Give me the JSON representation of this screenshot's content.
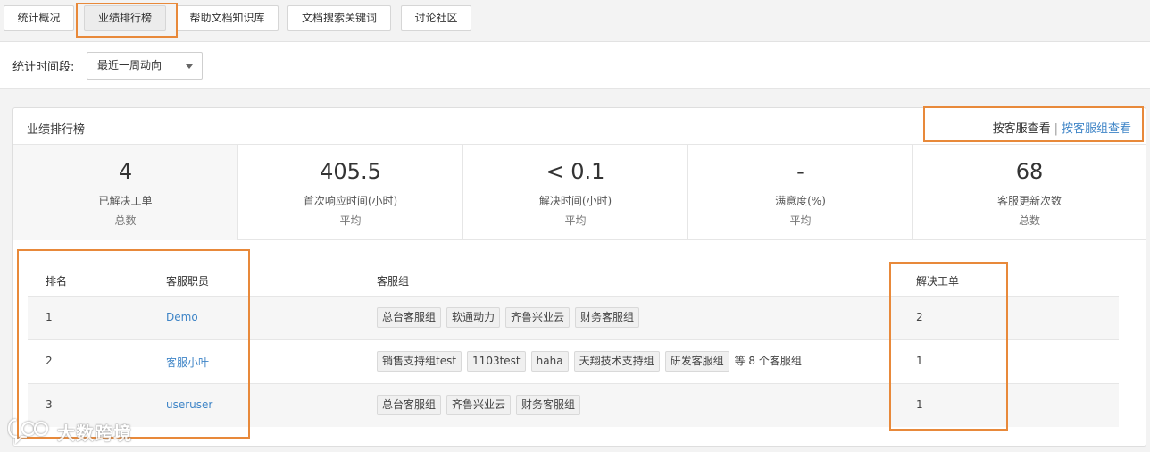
{
  "tabs": [
    {
      "label": "统计概况"
    },
    {
      "label": "业绩排行榜"
    },
    {
      "label": "帮助文档知识库"
    },
    {
      "label": "文档搜索关键词"
    },
    {
      "label": "讨论社区"
    }
  ],
  "filter": {
    "label": "统计时间段:",
    "selected": "最近一周动向"
  },
  "panel": {
    "title": "业绩排行榜",
    "view_by_agent": "按客服查看",
    "separator": "|",
    "view_by_group": "按客服组查看"
  },
  "stats": [
    {
      "value": "4",
      "label": "已解决工单",
      "agg": "总数"
    },
    {
      "value": "405.5",
      "label": "首次响应时间(小时)",
      "agg": "平均"
    },
    {
      "value": "< 0.1",
      "label": "解决时间(小时)",
      "agg": "平均"
    },
    {
      "value": "-",
      "label": "满意度(%)",
      "agg": "平均"
    },
    {
      "value": "68",
      "label": "客服更新次数",
      "agg": "总数"
    }
  ],
  "table": {
    "headers": {
      "rank": "排名",
      "agent": "客服职员",
      "groups": "客服组",
      "solved": "解决工单"
    },
    "rows": [
      {
        "rank": "1",
        "agent": "Demo",
        "groups": [
          "总台客服组",
          "软通动力",
          "齐鲁兴业云",
          "财务客服组"
        ],
        "more": "",
        "solved": "2"
      },
      {
        "rank": "2",
        "agent": "客服小叶",
        "groups": [
          "销售支持组test",
          "1103test",
          "haha",
          "天翔技术支持组",
          "研发客服组"
        ],
        "more": "等 8 个客服组",
        "solved": "1"
      },
      {
        "rank": "3",
        "agent": "useruser",
        "groups": [
          "总台客服组",
          "齐鲁兴业云",
          "财务客服组"
        ],
        "more": "",
        "solved": "1"
      }
    ]
  },
  "watermark": {
    "text": "大数跨境",
    "logo_icon": "speech-bubble-logo-icon"
  },
  "colors": {
    "accent": "#e8893a",
    "link": "#3f85c7"
  }
}
